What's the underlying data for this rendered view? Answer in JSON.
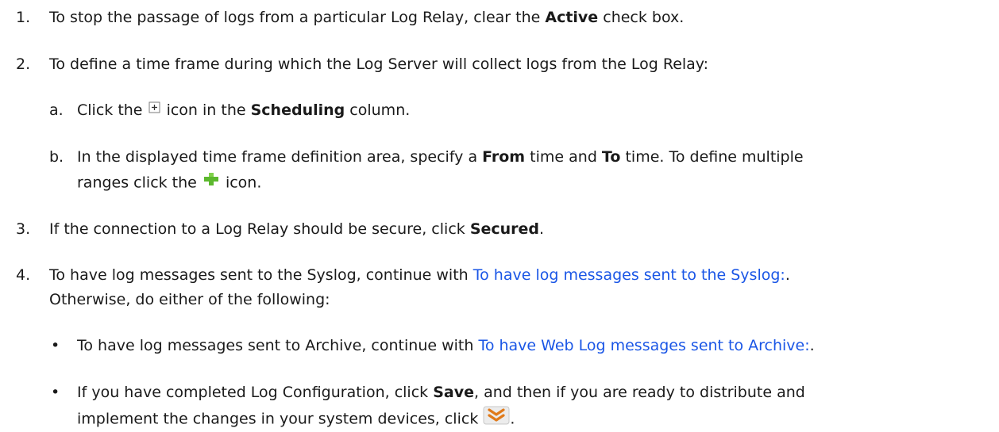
{
  "steps": {
    "s1": {
      "num": "1.",
      "pre": "To stop the passage of logs from a particular Log Relay, clear the ",
      "bold": "Active",
      "post": " check box."
    },
    "s2": {
      "num": "2.",
      "text": "To define a time frame during which the Log Server will collect logs from the Log Relay:",
      "a": {
        "letter": "a.",
        "pre": "Click the ",
        "mid": " icon in the ",
        "bold": "Scheduling",
        "post": " column."
      },
      "b": {
        "letter": "b.",
        "pre": "In the displayed time frame definition area, specify a ",
        "bold1": "From",
        "mid": " time and ",
        "bold2": "To",
        "post": " time. To define multiple",
        "line2_pre": "ranges click the ",
        "line2_post": " icon."
      }
    },
    "s3": {
      "num": "3.",
      "pre": "If the connection to a Log Relay should be secure, click ",
      "bold": "Secured",
      "post": "."
    },
    "s4": {
      "num": "4.",
      "pre": "To have log messages sent to the Syslog, continue with ",
      "link": "To have log messages sent to the Syslog:",
      "post": ".",
      "line2": "Otherwise, do either of the following:",
      "bullet1": {
        "mark": "•",
        "pre": "To have log messages sent to Archive, continue with ",
        "link": "To have Web Log messages sent to Archive:",
        "post": "."
      },
      "bullet2": {
        "mark": "•",
        "pre": "If you have completed Log Configuration, click ",
        "bold": "Save",
        "post": ", and then if you are ready to distribute and",
        "line2_pre": "implement the changes in your system devices, click ",
        "line2_post": "."
      }
    }
  },
  "icons": {
    "expand": "expand-plus-box-icon",
    "add": "green-plus-icon",
    "distribute": "distribute-chevrons-icon"
  },
  "colors": {
    "link": "#1a56e6",
    "text": "#1a1a1a",
    "add_icon": "#5cb82e",
    "distribute_icon": "#e07a1a"
  }
}
